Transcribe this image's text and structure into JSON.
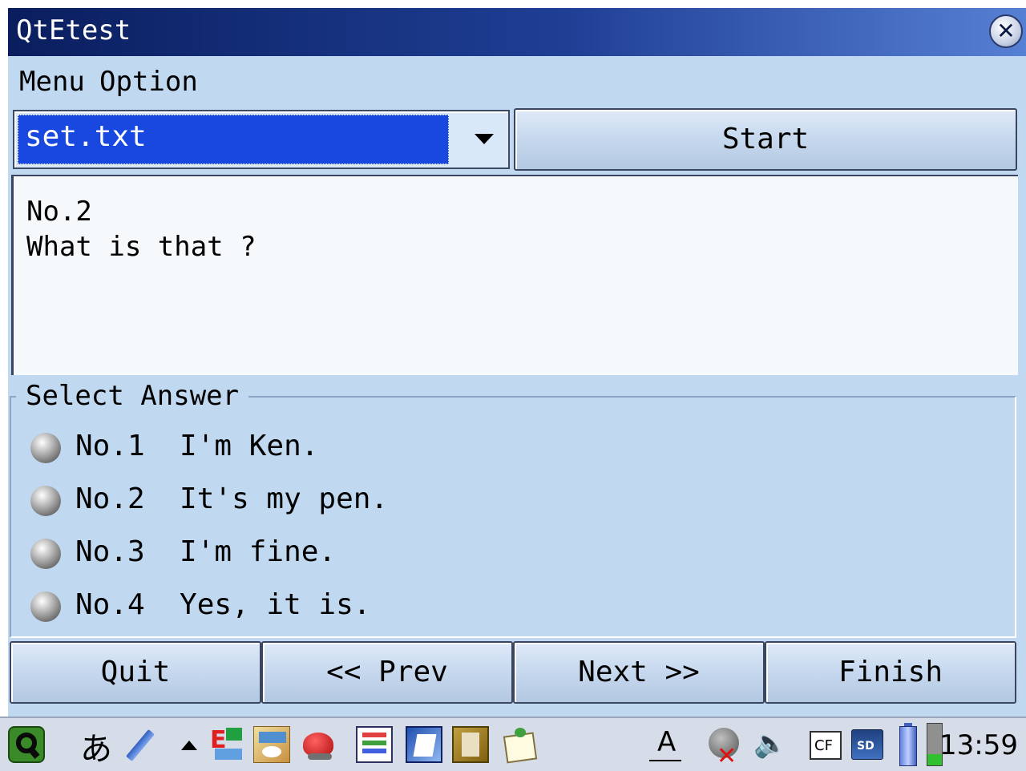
{
  "window": {
    "title": "QtEtest"
  },
  "menubar": {
    "items": [
      "Menu",
      "Option"
    ]
  },
  "file_select": {
    "value": "set.txt"
  },
  "start_button": {
    "label": "Start"
  },
  "question": {
    "number": "No.2",
    "text": "What is that ?"
  },
  "answers": {
    "title": "Select Answer",
    "options": [
      {
        "label": "No.1  I'm Ken."
      },
      {
        "label": "No.2  It's my pen."
      },
      {
        "label": "No.3  I'm fine."
      },
      {
        "label": "No.4  Yes, it is."
      }
    ]
  },
  "buttons": {
    "quit": "Quit",
    "prev": "<< Prev",
    "next": "Next >>",
    "finish": "Finish"
  },
  "taskbar": {
    "input_mode": "あ",
    "clock": "13:59",
    "icons": [
      "qtopia-start-icon",
      "input-method-icon",
      "pen-icon",
      "up-arrow-icon",
      "english-test-app-icon",
      "map-app-icon",
      "game-app-icon",
      "spreadsheet-app-icon",
      "notes-app-icon",
      "book-app-icon",
      "calendar-app-icon",
      "font-icon",
      "network-disconnected-icon",
      "volume-icon",
      "cf-card-icon",
      "sd-card-icon",
      "battery-icon"
    ]
  }
}
